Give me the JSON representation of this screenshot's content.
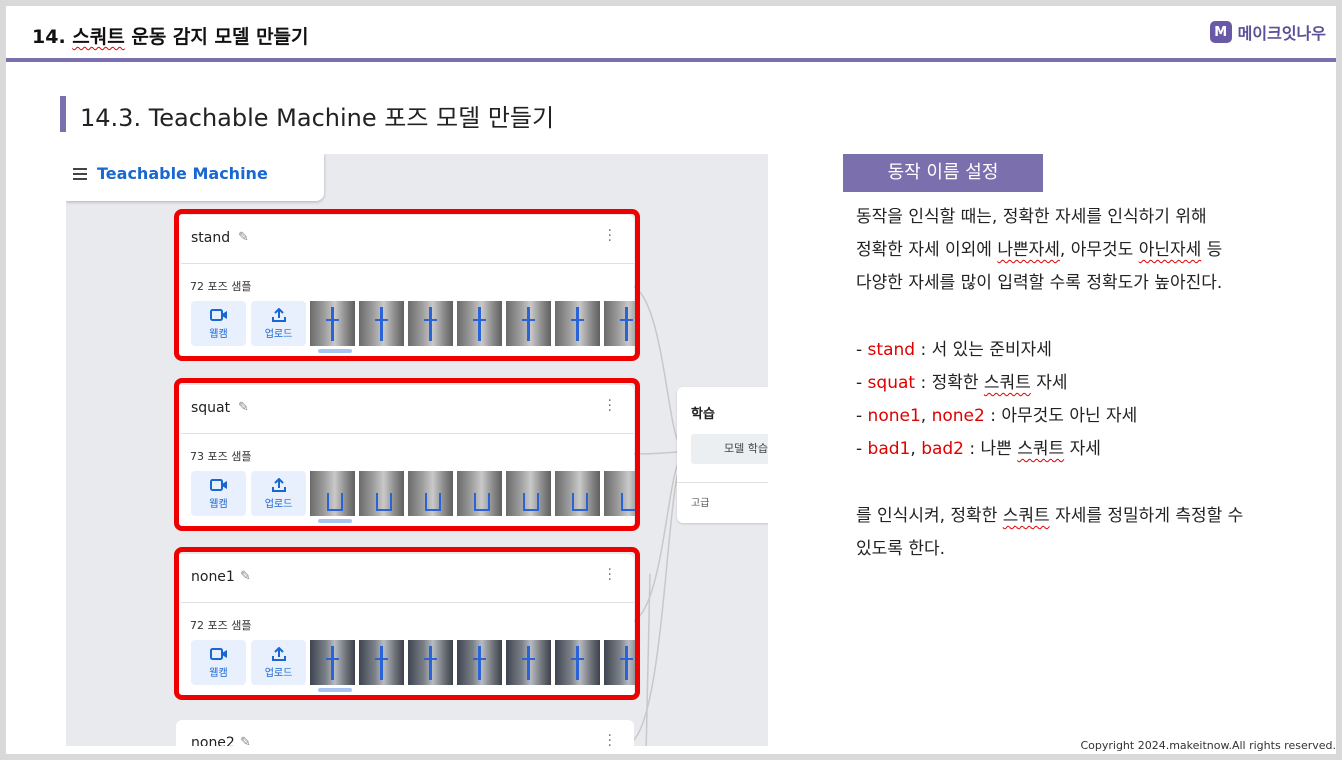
{
  "header": {
    "title_prefix": "14. ",
    "title_underlined": "스쿼트",
    "title_suffix": " 운동 감지 모델 만들기",
    "logo_letter": "M",
    "logo_text": "메이크잇나우",
    "accent_color": "#7b6fae"
  },
  "section": {
    "title": "14.3. Teachable Machine 포즈 모델 만들기"
  },
  "app": {
    "title": "Teachable Machine",
    "classes": [
      {
        "name": "stand",
        "samples": "72 포즈 샘플",
        "webcam_label": "웹캠",
        "upload_label": "업로드"
      },
      {
        "name": "squat",
        "samples": "73 포즈 샘플",
        "webcam_label": "웹캠",
        "upload_label": "업로드"
      },
      {
        "name": "none1",
        "samples": "72 포즈 샘플",
        "webcam_label": "웹캠",
        "upload_label": "업로드"
      },
      {
        "name": "none2"
      }
    ],
    "training": {
      "title": "학습",
      "button": "모델 학습",
      "advanced": "고급"
    }
  },
  "content": {
    "badge": "동작 이름 설정",
    "intro_line1": "동작을 인식할 때는, 정확한 자세를 인식하기 위해",
    "intro_line2_a": "정확한 자세 이외에 ",
    "intro_line2_u1": "나쁜자세",
    "intro_line2_b": ", 아무것도 ",
    "intro_line2_u2": "아닌자세",
    "intro_line2_c": " 등",
    "intro_line3": "다양한 자세를 많이 입력할 수록 정확도가 높아진다.",
    "items": [
      {
        "dash": "- ",
        "red1": "stand",
        "sep": "",
        "red2": "",
        "rest": " : 서 있는 준비자세"
      },
      {
        "dash": "- ",
        "red1": "squat",
        "sep": "",
        "red2": "",
        "rest": " : 정확한 스쿼트 자세"
      },
      {
        "dash": "- ",
        "red1": "none1",
        "sep": ", ",
        "red2": "none2",
        "rest": " : 아무것도 아닌 자세"
      },
      {
        "dash": "- ",
        "red1": "bad1",
        "sep": ", ",
        "red2": "bad2",
        "rest": " : 나쁜 스쿼트 자세"
      }
    ],
    "outro_line1": "를 인식시켜, 정확한 스쿼트 자세를 정밀하게 측정할 수",
    "outro_line2": "있도록 한다."
  },
  "footer": {
    "copyright": "Copyright 2024.makeitnow.All rights reserved."
  }
}
